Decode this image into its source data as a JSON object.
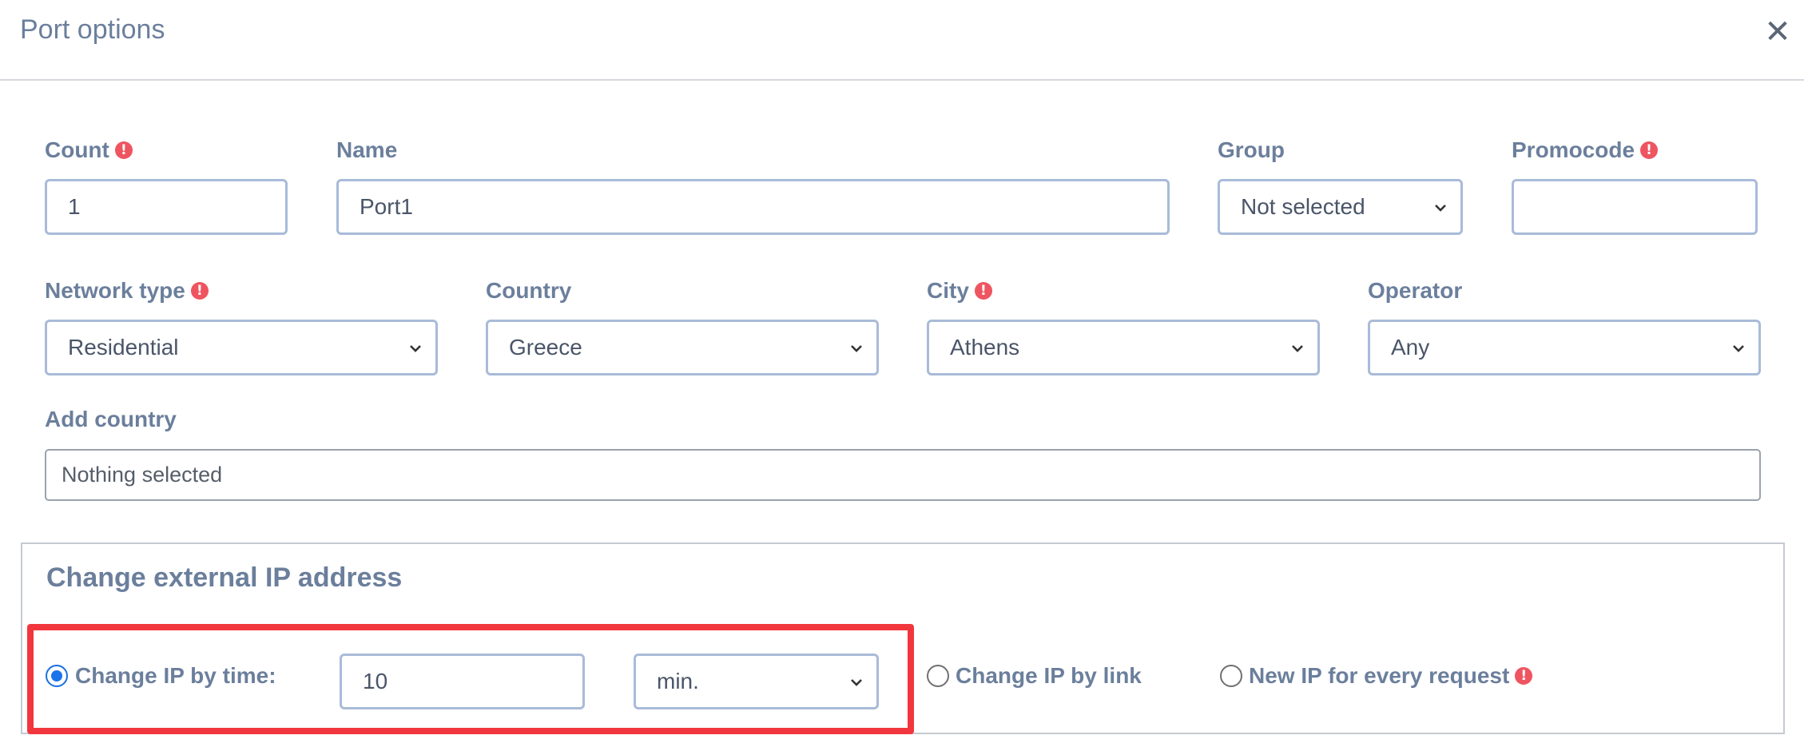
{
  "modal": {
    "title": "Port options",
    "close_glyph": "✕"
  },
  "fields": {
    "count": {
      "label": "Count",
      "value": "1"
    },
    "name": {
      "label": "Name",
      "value": "Port1"
    },
    "group": {
      "label": "Group",
      "selected": "Not selected"
    },
    "promocode": {
      "label": "Promocode",
      "value": ""
    },
    "network_type": {
      "label": "Network type",
      "selected": "Residential"
    },
    "country": {
      "label": "Country",
      "selected": "Greece"
    },
    "city": {
      "label": "City",
      "selected": "Athens"
    },
    "operator": {
      "label": "Operator",
      "selected": "Any"
    },
    "add_country": {
      "label": "Add country",
      "placeholder": "Nothing selected"
    }
  },
  "ip_change": {
    "title": "Change external IP address",
    "by_time": {
      "label": "Change IP by time:",
      "value": "10",
      "unit": "min.",
      "checked": true
    },
    "by_link": {
      "label": "Change IP by link",
      "checked": false
    },
    "every_request": {
      "label": "New IP for every request",
      "checked": false
    }
  },
  "icons": {
    "warning": "exclamation-circle-icon",
    "chevron": "chevron-down-icon",
    "close": "close-icon"
  },
  "colors": {
    "label": "#6b7f9c",
    "input_border": "#a9bbd8",
    "warning": "#ee5560",
    "radio_active": "#1a73e8",
    "highlight": "#f2363d"
  }
}
